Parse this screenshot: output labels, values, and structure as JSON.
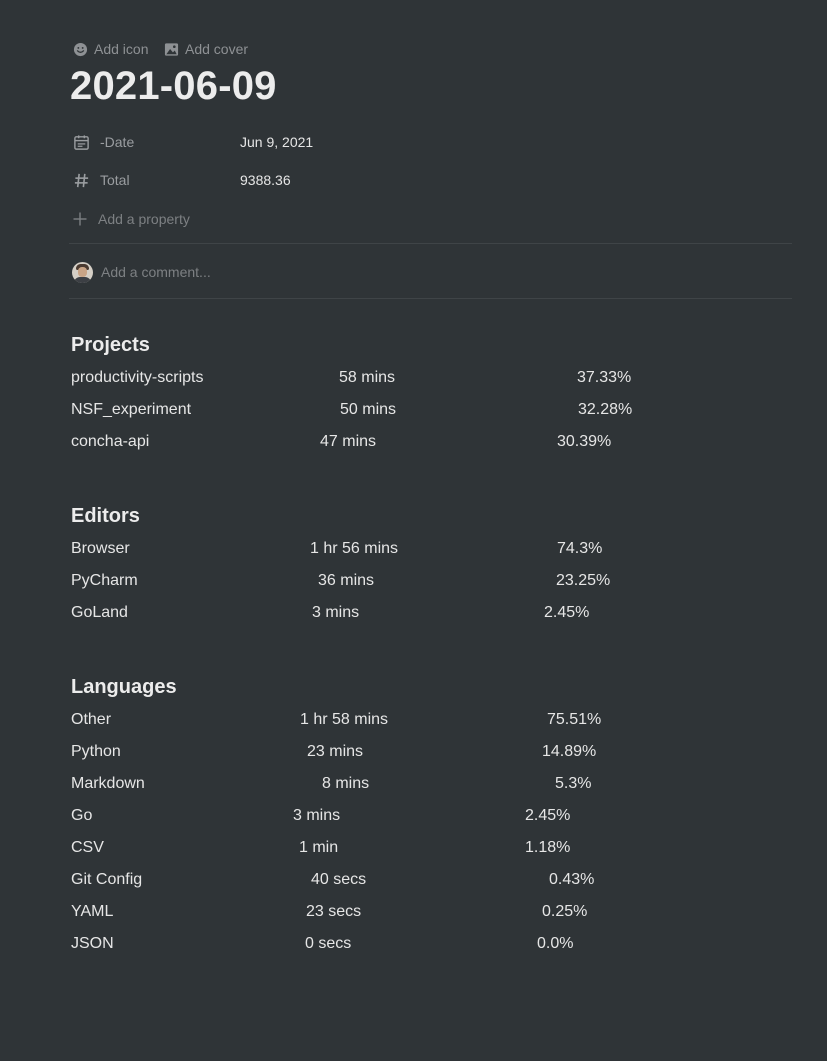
{
  "top_actions": {
    "add_icon_label": "Add icon",
    "add_cover_label": "Add cover"
  },
  "page": {
    "title": "2021-06-09"
  },
  "properties": [
    {
      "icon": "calendar-icon",
      "name": "-Date",
      "value": "Jun 9, 2021"
    },
    {
      "icon": "hash-icon",
      "name": "Total",
      "value": "9388.36"
    }
  ],
  "add_property_label": "Add a property",
  "comment": {
    "placeholder": "Add a comment..."
  },
  "sections": {
    "projects": {
      "heading": "Projects",
      "rows": [
        {
          "name": "productivity-scripts",
          "duration": "58 mins",
          "percent": "37.33%"
        },
        {
          "name": "NSF_experiment",
          "duration": "50 mins",
          "percent": "32.28%"
        },
        {
          "name": "concha-api",
          "duration": "47 mins",
          "percent": "30.39%"
        }
      ]
    },
    "editors": {
      "heading": "Editors",
      "rows": [
        {
          "name": "Browser",
          "duration": "1 hr 56 mins",
          "percent": "74.3%"
        },
        {
          "name": "PyCharm",
          "duration": "36 mins",
          "percent": "23.25%"
        },
        {
          "name": "GoLand",
          "duration": "3 mins",
          "percent": "2.45%"
        }
      ]
    },
    "languages": {
      "heading": "Languages",
      "rows": [
        {
          "name": "Other",
          "duration": "1 hr 58 mins",
          "percent": "75.51%"
        },
        {
          "name": "Python",
          "duration": "23 mins",
          "percent": "14.89%"
        },
        {
          "name": "Markdown",
          "duration": "8 mins",
          "percent": "5.3%"
        },
        {
          "name": "Go",
          "duration": "3 mins",
          "percent": "2.45%"
        },
        {
          "name": "CSV",
          "duration": "1 min",
          "percent": "1.18%"
        },
        {
          "name": "Git Config",
          "duration": "40 secs",
          "percent": "0.43%"
        },
        {
          "name": "YAML",
          "duration": "23 secs",
          "percent": "0.25%"
        },
        {
          "name": "JSON",
          "duration": "0 secs",
          "percent": "0.0%"
        }
      ]
    }
  }
}
